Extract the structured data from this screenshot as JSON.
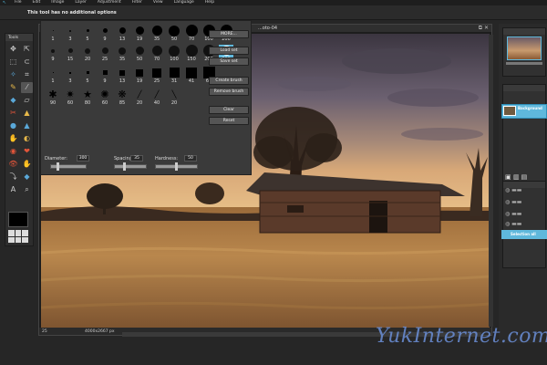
{
  "menubar": {
    "items": [
      "File",
      "Edit",
      "Image",
      "Layer",
      "Adjustment",
      "Filter",
      "View",
      "Language",
      "Help"
    ]
  },
  "options_bar": {
    "message": "This tool has no additional options"
  },
  "toolbox": {
    "title": "Tools",
    "foreground_color": "#000000"
  },
  "canvas": {
    "title": "...oto-04",
    "zoom": "25",
    "dimensions": "4000x2667 px"
  },
  "brush_panel": {
    "rows": [
      {
        "sizes": [
          "1",
          "3",
          "5",
          "9",
          "13",
          "19",
          "5",
          "9",
          "13",
          "17",
          "21",
          "27"
        ]
      },
      {
        "sizes": [
          "35",
          "45",
          "65",
          "100",
          "200",
          "300"
        ]
      }
    ],
    "row1_numbers": [
      "1",
      "3",
      "5",
      "9",
      "13",
      "19",
      "35",
      "50",
      "70",
      "100",
      "200"
    ],
    "row2_numbers": [
      "9",
      "15",
      "20",
      "25",
      "35",
      "50",
      "70",
      "100",
      "150",
      "200"
    ],
    "row3_numbers": [
      "1",
      "3",
      "5",
      "9",
      "13",
      "19",
      "25",
      "31",
      "41",
      "61"
    ],
    "row4_numbers": [
      "90",
      "60",
      "80",
      "60",
      "85",
      "20",
      "40",
      "20"
    ],
    "selected_label": "300",
    "buttons": {
      "more": "MORE...",
      "load_set": "Load set",
      "save_set": "Save set",
      "create_brush": "Create brush",
      "remove_brush": "Remove brush",
      "clear": "Clear",
      "reset": "Reset"
    },
    "sliders": {
      "diameter_label": "Diameter:",
      "diameter_value": "300",
      "spacing_label": "Spacing:",
      "spacing_value": "35",
      "hardness_label": "Hardness:",
      "hardness_value": "50"
    }
  },
  "layers": {
    "name": "Background"
  },
  "history": {
    "selected": "Selection all"
  },
  "watermark": "YukInternet.com",
  "colors": {
    "accent": "#5fb8dc",
    "panel": "#3a3a3a",
    "background": "#262626"
  }
}
